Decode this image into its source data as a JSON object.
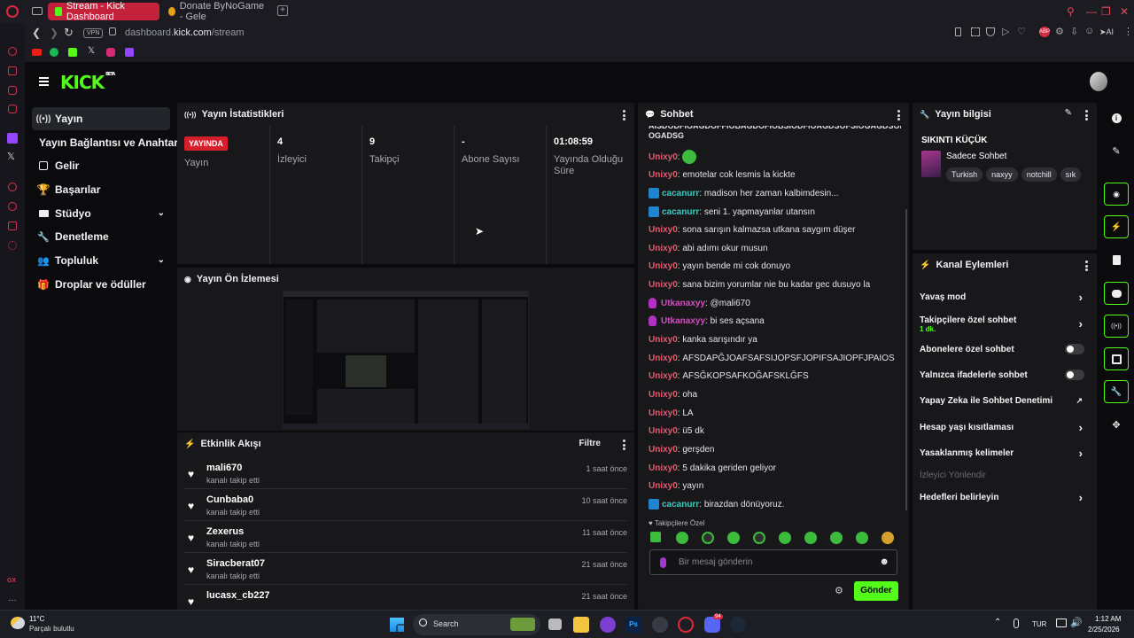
{
  "browser": {
    "tabs": [
      {
        "title": "Stream - Kick Dashboard",
        "active": true
      },
      {
        "title": "Donate ByNoGame - Gele",
        "active": false
      }
    ],
    "url_prefix": "dashboard.",
    "url_host": "kick.com",
    "url_path": "/stream",
    "vpn_label": "VPN",
    "ai_label": "AI"
  },
  "kick": {
    "logo": "KICK",
    "logo_sup": "BETA",
    "nav": [
      {
        "label": "Yayın",
        "icon": "broadcast-icon",
        "active": true
      },
      {
        "label": "Yayın Bağlantısı ve Anahtarı",
        "icon": "",
        "active": false
      },
      {
        "label": "Gelir",
        "icon": "revenue-icon"
      },
      {
        "label": "Başarılar",
        "icon": "trophy-icon"
      },
      {
        "label": "Stüdyo",
        "icon": "studio-icon",
        "expandable": true
      },
      {
        "label": "Denetleme",
        "icon": "wrench-icon"
      },
      {
        "label": "Topluluk",
        "icon": "community-icon",
        "expandable": true
      },
      {
        "label": "Droplar ve ödüller",
        "icon": "drops-icon"
      }
    ],
    "stats": {
      "title": "Yayın İstatistikleri",
      "live_badge": "YAYINDA",
      "live_label": "Yayın",
      "items": [
        {
          "value": "4",
          "label": "İzleyici"
        },
        {
          "value": "9",
          "label": "Takipçi"
        },
        {
          "value": "-",
          "label": "Abone Sayısı"
        },
        {
          "value": "01:08:59",
          "label": "Yayında Olduğu Süre"
        }
      ]
    },
    "preview": {
      "title": "Yayın Ön İzlemesi"
    },
    "activity": {
      "title": "Etkinlik Akışı",
      "filter": "Filtre",
      "items": [
        {
          "name": "mali670",
          "action": "kanalı takip etti",
          "time": "1 saat önce"
        },
        {
          "name": "Cunbaba0",
          "action": "kanalı takip etti",
          "time": "10 saat önce"
        },
        {
          "name": "Zexerus",
          "action": "kanalı takip etti",
          "time": "11 saat önce"
        },
        {
          "name": "Siracberat07",
          "action": "kanalı takip etti",
          "time": "21 saat önce"
        },
        {
          "name": "lucasx_cb227",
          "action": "",
          "time": "21 saat önce"
        }
      ]
    },
    "chat": {
      "title": "Sohbet",
      "top_cut": "AISDODFIOAGDOFFIOBAGDOFIOBSIODFIOAGDSOFSIOGAGDSODAGSOIOA",
      "top_cut2": "OGADSG",
      "messages": [
        {
          "user": "Unixy0",
          "color": "red",
          "text": "",
          "emote": true
        },
        {
          "user": "Unixy0",
          "color": "red",
          "text": "emotelar cok lesmis la kickte"
        },
        {
          "user": "cacanurr",
          "color": "teal",
          "badge": "vip",
          "text": "madison her zaman kalbimdesin..."
        },
        {
          "user": "cacanurr",
          "color": "teal",
          "badge": "vip",
          "text": "seni 1. yapmayanlar utansın"
        },
        {
          "user": "Unixy0",
          "color": "red",
          "text": "sona sarışın kalmazsa utkana saygım düşer"
        },
        {
          "user": "Unixy0",
          "color": "red",
          "text": "abi adımı okur musun"
        },
        {
          "user": "Unixy0",
          "color": "red",
          "text": "yayın bende mi cok donuyo"
        },
        {
          "user": "Unixy0",
          "color": "red",
          "text": "sana bizim yorumlar nie bu kadar gec dusuyo la"
        },
        {
          "user": "Utkanaxyy",
          "color": "pink",
          "badge": "mic",
          "text": "@mali670"
        },
        {
          "user": "Utkanaxyy",
          "color": "pink",
          "badge": "mic",
          "text": "bi ses açsana"
        },
        {
          "user": "Unixy0",
          "color": "red",
          "text": "kanka sarışındır ya"
        },
        {
          "user": "Unixy0",
          "color": "red",
          "text": "AFSDAPĞJOAFSAFSIJOPSFJOPIFSAJIOPFJPAIOS"
        },
        {
          "user": "Unixy0",
          "color": "red",
          "text": "AFSĞKOPSAFKOĞAFSKLĞFS"
        },
        {
          "user": "Unixy0",
          "color": "red",
          "text": "oha"
        },
        {
          "user": "Unixy0",
          "color": "red",
          "text": "LA"
        },
        {
          "user": "Unixy0",
          "color": "red",
          "text": "ü5 dk"
        },
        {
          "user": "Unixy0",
          "color": "red",
          "text": "gerşden"
        },
        {
          "user": "Unixy0",
          "color": "red",
          "text": "5 dakika geriden geliyor"
        },
        {
          "user": "Unixy0",
          "color": "red",
          "text": "yayın"
        },
        {
          "user": "cacanurr",
          "color": "teal",
          "badge": "vip",
          "text": "birazdan dönüyoruz."
        }
      ],
      "followers_only_label": "Takipçilere Özel",
      "input_placeholder": "Bir mesaj gönderin",
      "send": "Gönder"
    },
    "stream_info": {
      "title": "Yayın bilgisi",
      "stream_title": "SIKINTI KÜÇÜK",
      "category": "Sadece Sohbet",
      "tags": [
        "Turkish",
        "naxyy",
        "notchill",
        "sık"
      ]
    },
    "channel_actions": {
      "title": "Kanal Eylemleri",
      "items": [
        {
          "label": "Yavaş mod",
          "type": "chevron"
        },
        {
          "label": "Takipçilere özel sohbet",
          "sub": "1 dk.",
          "type": "chevron"
        },
        {
          "label": "Abonelere özel sohbet",
          "type": "toggle"
        },
        {
          "label": "Yalnızca ifadelerle sohbet",
          "type": "toggle"
        },
        {
          "label": "Yapay Zeka ile Sohbet Denetimi",
          "type": "external"
        },
        {
          "label": "Hesap yaşı kısıtlaması",
          "type": "chevron"
        },
        {
          "label": "Yasaklanmış kelimeler",
          "type": "chevron"
        },
        {
          "label": "İzleyici Yönlendir",
          "type": "disabled"
        },
        {
          "label": "Hedefleri belirleyin",
          "type": "chevron"
        }
      ]
    }
  },
  "taskbar": {
    "weather_temp": "11°C",
    "weather_text": "Parçalı bulutlu",
    "search": "Search",
    "lang": "TUR",
    "time": "1:12 AM",
    "date": "2/25/2026",
    "discord_badge": "94"
  },
  "colors": {
    "kick_green": "#53fc18",
    "opera_red": "#e0283d"
  }
}
